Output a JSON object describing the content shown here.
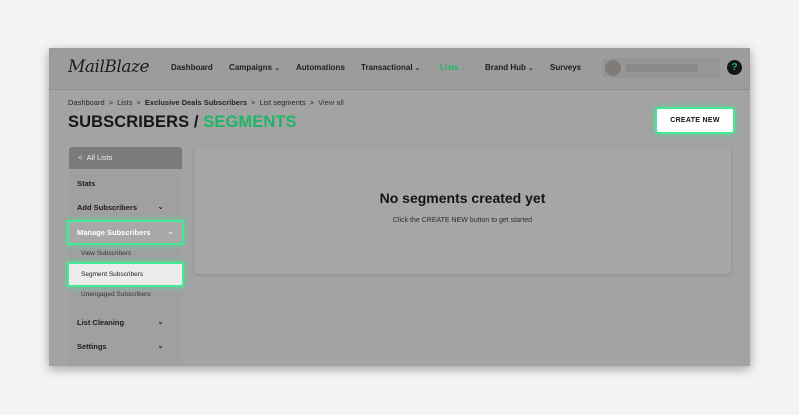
{
  "nav": {
    "logo": "MailBlaze",
    "items": [
      {
        "label": "Dashboard",
        "has_dropdown": false,
        "active": false
      },
      {
        "label": "Campaigns",
        "has_dropdown": true,
        "active": false
      },
      {
        "label": "Automations",
        "has_dropdown": false,
        "active": false
      },
      {
        "label": "Transactional",
        "has_dropdown": true,
        "active": false
      },
      {
        "label": "Lists",
        "has_dropdown": true,
        "active": true
      },
      {
        "label": "Brand Hub",
        "has_dropdown": true,
        "active": false
      },
      {
        "label": "Surveys",
        "has_dropdown": false,
        "active": false
      }
    ],
    "help_glyph": "?",
    "dropdown_glyph": "⌄"
  },
  "breadcrumb": {
    "items": [
      "Dashboard",
      "Lists",
      "Exclusive Deals Subscribers",
      "List segments",
      "View all"
    ],
    "separator": ">"
  },
  "page": {
    "title_main": "SUBSCRIBERS /",
    "title_accent": "SEGMENTS",
    "create_button": "CREATE NEW"
  },
  "sidebar": {
    "back_glyph": "<",
    "back_label": "All Lists",
    "chevron_glyph": "⌄",
    "items": [
      {
        "label": "Stats",
        "expandable": false
      },
      {
        "label": "Add Subscribers",
        "expandable": true
      },
      {
        "label": "Manage Subscribers",
        "expandable": true,
        "expanded": true
      },
      {
        "label": "List Cleaning",
        "expandable": true
      },
      {
        "label": "Settings",
        "expandable": true
      }
    ],
    "sub_items": [
      "View Subscribers",
      "Segment Subscribers",
      "Unengaged Subscribers"
    ]
  },
  "empty_state": {
    "title": "No segments created yet",
    "subtitle": "Click the CREATE NEW button to get started"
  },
  "colors": {
    "accent": "#1fb566",
    "highlight": "#45e894"
  }
}
